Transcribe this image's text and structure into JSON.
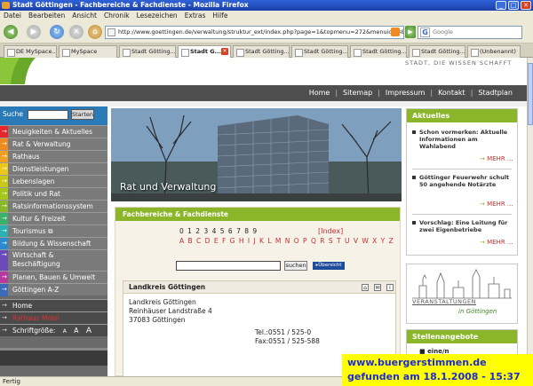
{
  "window": {
    "title": "Stadt Göttingen - Fachbereiche & Fachdienste - Mozilla Firefox",
    "min": "_",
    "max": "□",
    "close": "✕"
  },
  "menubar": [
    "Datei",
    "Bearbeiten",
    "Ansicht",
    "Chronik",
    "Lesezeichen",
    "Extras",
    "Hilfe"
  ],
  "toolbar": {
    "url": "http://www.goettingen.de/verwaltung/struktur_ext/index.php?page=1&topmenu=272&menuid=3&letter=",
    "search_placeholder": "Google",
    "search_engine_letter": "G",
    "back": "◀",
    "forward": "▶",
    "reload": "↻",
    "stop": "✕",
    "home": "⌂"
  },
  "tabs": [
    {
      "label": "DE MySpace..."
    },
    {
      "label": "MySpace"
    },
    {
      "label": "Stadt Götting..."
    },
    {
      "label": "Stadt G...",
      "active": true
    },
    {
      "label": "Stadt Götting..."
    },
    {
      "label": "Stadt Götting..."
    },
    {
      "label": "Stadt Götting..."
    },
    {
      "label": "Stadt Götting..."
    },
    {
      "label": "(Unbenannt)"
    }
  ],
  "site": {
    "slogan": "STADT, DIE WISSEN SCHAFFT",
    "topnav": [
      "Home",
      "Sitemap",
      "Impressum",
      "Kontakt",
      "Stadtplan"
    ],
    "search_label": "Suche",
    "search_button": "Starten"
  },
  "sidebar": {
    "items": [
      {
        "label": "Neuigkeiten & Aktuelles",
        "color": "#e8262a"
      },
      {
        "label": "Rat & Verwaltung",
        "color": "#f08a1c"
      },
      {
        "label": "Rathaus",
        "color": "#f0a020"
      },
      {
        "label": "Dienstleistungen",
        "color": "#ecc81a"
      },
      {
        "label": "Lebenslagen",
        "color": "#c8c81a"
      },
      {
        "label": "Politik und Rat",
        "color": "#a6c61a"
      },
      {
        "label": "Ratsinformationssystem",
        "color": "#8ab82a"
      },
      {
        "label": "Kultur & Freizeit",
        "color": "#3ab06a"
      },
      {
        "label": "Tourismus",
        "color": "#2ab0b0"
      },
      {
        "label": "Bildung & Wissenschaft",
        "color": "#2a8ad0"
      },
      {
        "label": "Wirtschaft & Beschäftigung",
        "color": "#6a4ab8"
      },
      {
        "label": "Planen, Bauen & Umwelt",
        "color": "#b83aa0"
      },
      {
        "label": "Göttingen A-Z",
        "color": "#3a6ab8"
      }
    ],
    "dark_items": [
      {
        "label": "Home"
      },
      {
        "label": "Rathaus Mobil"
      }
    ],
    "fontsize_label": "Schriftgröße:",
    "fontsize_options": [
      "A",
      "A",
      "A"
    ]
  },
  "banner": {
    "label": "Rat und Verwaltung"
  },
  "fach": {
    "title": "Fachbereiche & Fachdienste",
    "index": "[Index]",
    "digits": "0 1 2 3 4 5 6 7 8 9",
    "letters": "A B C D E F G H I J K L M N O P Q R S T U V W X Y Z",
    "search_button": "suchen",
    "overview_button": "Übersicht"
  },
  "landkreis": {
    "title": "Landkreis Göttingen",
    "address": [
      "Landkreis Göttingen",
      "Reinhäuser Landstraße 4",
      "37083 Göttingen"
    ],
    "tel": "Tel.:0551 / 525-0",
    "fax": "Fax:0551 / 525-588"
  },
  "aktuelles": {
    "title": "Aktuelles",
    "items": [
      {
        "text": "Schon vormerken: Aktuelle Informationen am Wahlabend"
      },
      {
        "text": "Göttinger Feuerwehr schult 50 angehende Notärzte"
      },
      {
        "text": "Vorschlag: Eine Leitung für zwei Eigenbetriebe"
      }
    ],
    "more_label": "MEHR ..."
  },
  "veranstaltungen": {
    "line1": "VERANSTALTUNGEN",
    "line2": "in Göttingen"
  },
  "stellen": {
    "title": "Stellenangebote",
    "first": "eine/n"
  },
  "status": "Fertig",
  "overlay": {
    "line1": "www.buergerstimmen.de",
    "line2": "gefunden am 18.1.2008 - 15:37"
  }
}
